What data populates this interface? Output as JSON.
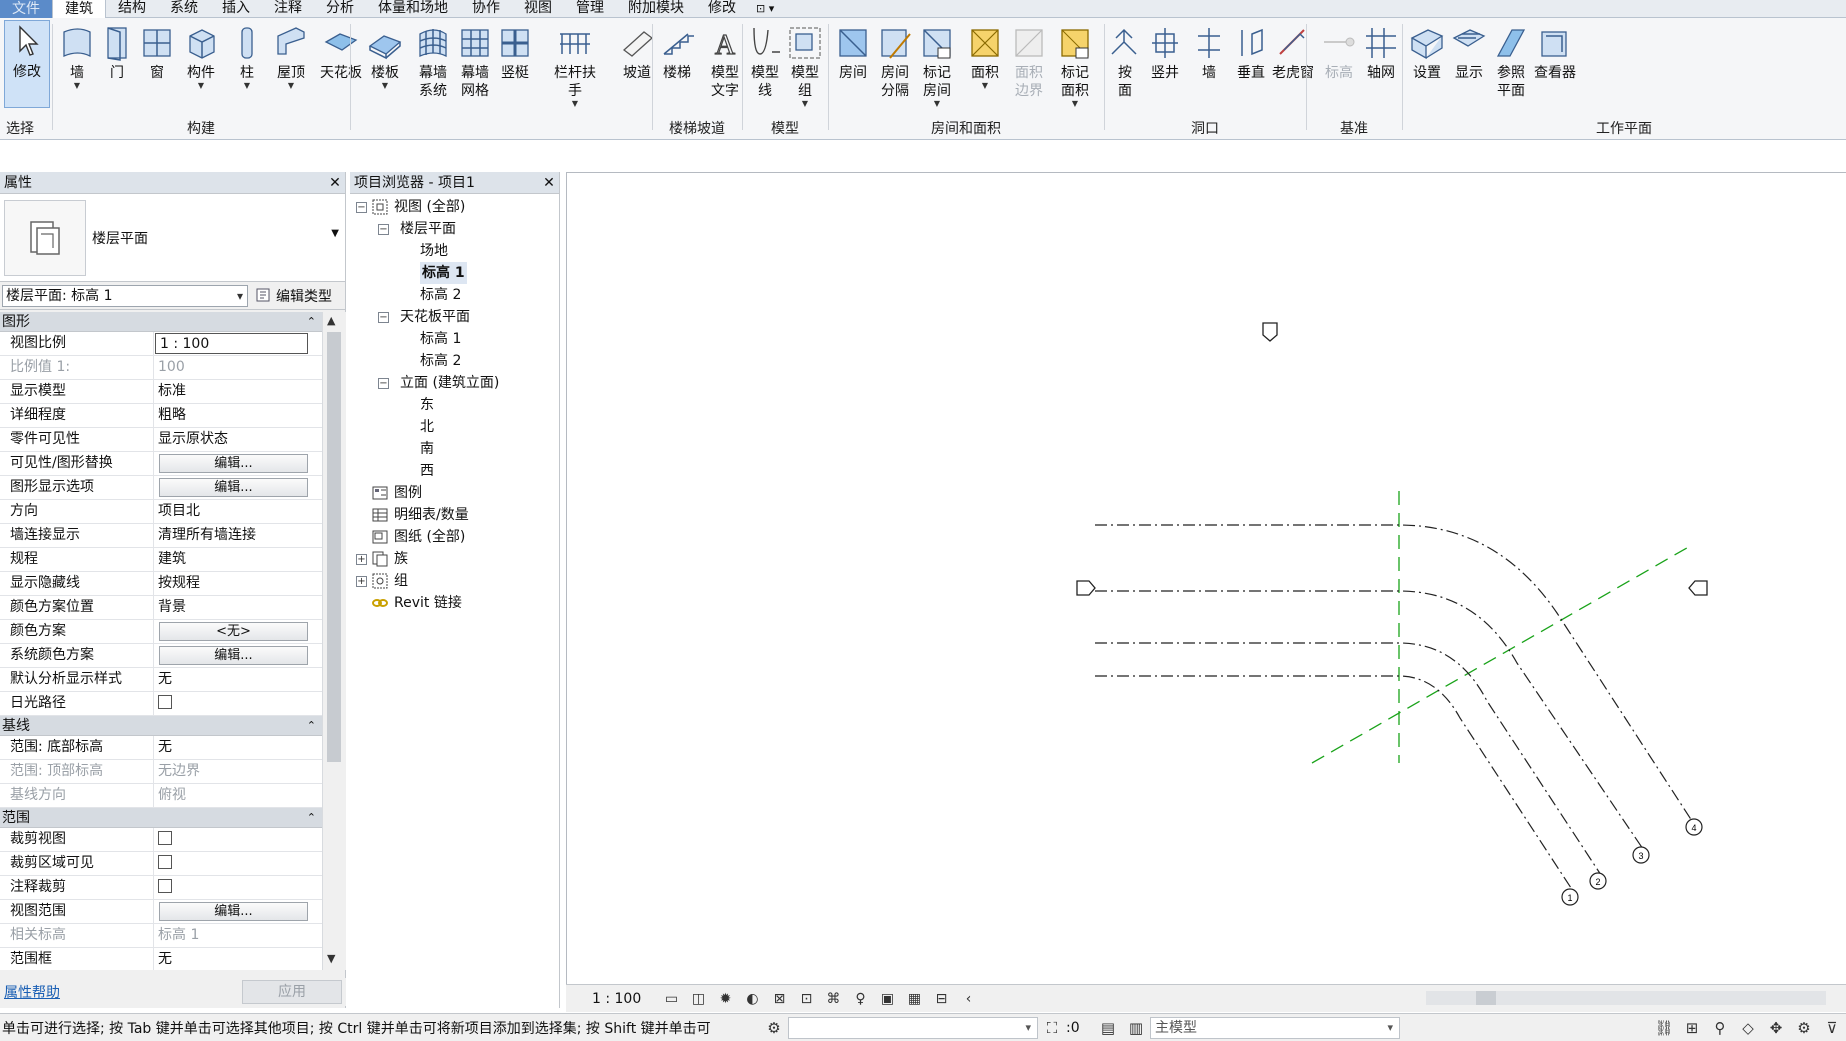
{
  "menu": {
    "file": "文件",
    "tabs": [
      "建筑",
      "结构",
      "系统",
      "插入",
      "注释",
      "分析",
      "体量和场地",
      "协作",
      "视图",
      "管理",
      "附加模块",
      "修改"
    ],
    "active": "建筑",
    "extra": "⊡ ▾"
  },
  "ribbon": {
    "buttons": [
      {
        "name": "modify",
        "label": "修改",
        "icon": "cursor-icon"
      },
      {
        "name": "wall",
        "label": "墙",
        "icon": "wall-icon",
        "caret": true
      },
      {
        "name": "door",
        "label": "门",
        "icon": "door-icon"
      },
      {
        "name": "window",
        "label": "窗",
        "icon": "window-icon"
      },
      {
        "name": "component",
        "label": "构件",
        "icon": "component-icon",
        "caret": true
      },
      {
        "name": "column",
        "label": "柱",
        "icon": "column-icon",
        "caret": true
      },
      {
        "name": "roof",
        "label": "屋顶",
        "icon": "roof-icon",
        "caret": true
      },
      {
        "name": "ceiling",
        "label": "天花板",
        "icon": "ceiling-icon"
      },
      {
        "name": "floor",
        "label": "楼板",
        "icon": "floor-icon",
        "caret": true
      },
      {
        "name": "curtain-system",
        "label": "幕墙\n系统",
        "icon": "curtain-system-icon"
      },
      {
        "name": "curtain-grid",
        "label": "幕墙\n网格",
        "icon": "curtain-grid-icon"
      },
      {
        "name": "mullion",
        "label": "竖梃",
        "icon": "mullion-icon"
      },
      {
        "name": "railing",
        "label": "栏杆扶手",
        "icon": "railing-icon",
        "caret": true
      },
      {
        "name": "ramp",
        "label": "坡道",
        "icon": "ramp-icon"
      },
      {
        "name": "stair",
        "label": "楼梯",
        "icon": "stair-icon"
      },
      {
        "name": "model-text",
        "label": "模型\n文字",
        "icon": "model-text-icon"
      },
      {
        "name": "model-line",
        "label": "模型\n线",
        "icon": "model-line-icon"
      },
      {
        "name": "model-group",
        "label": "模型\n组",
        "icon": "model-group-icon",
        "caret": true
      },
      {
        "name": "room",
        "label": "房间",
        "icon": "room-icon"
      },
      {
        "name": "room-separator",
        "label": "房间\n分隔",
        "icon": "room-separator-icon"
      },
      {
        "name": "tag-room",
        "label": "标记\n房间",
        "icon": "tag-room-icon",
        "caret": true
      },
      {
        "name": "area",
        "label": "面积",
        "icon": "area-icon",
        "caret": true
      },
      {
        "name": "area-boundary",
        "label": "面积\n边界",
        "icon": "area-boundary-icon",
        "dim": true
      },
      {
        "name": "tag-area",
        "label": "标记\n面积",
        "icon": "tag-area-icon",
        "caret": true
      },
      {
        "name": "by-face",
        "label": "按\n面",
        "icon": "by-face-icon"
      },
      {
        "name": "shaft",
        "label": "竖井",
        "icon": "shaft-icon"
      },
      {
        "name": "wall-opening",
        "label": "墙",
        "icon": "wall-opening-icon"
      },
      {
        "name": "vertical",
        "label": "垂直",
        "icon": "vertical-opening-icon"
      },
      {
        "name": "dormer",
        "label": "老虎窗",
        "icon": "dormer-icon"
      },
      {
        "name": "level",
        "label": "标高",
        "icon": "level-icon",
        "dim": true
      },
      {
        "name": "grid",
        "label": "轴网",
        "icon": "grid-icon"
      },
      {
        "name": "set",
        "label": "设置",
        "icon": "set-workplane-icon"
      },
      {
        "name": "show",
        "label": "显示",
        "icon": "show-workplane-icon"
      },
      {
        "name": "ref-plane",
        "label": "参照\n平面",
        "icon": "ref-plane-icon"
      },
      {
        "name": "viewer",
        "label": "查看器",
        "icon": "viewer-icon"
      }
    ],
    "groups": {
      "select": "选择",
      "build": "构建",
      "circulation": "楼梯坡道",
      "model": "模型",
      "room_area": "房间和面积",
      "opening": "洞口",
      "datum": "基准",
      "workplane": "工作平面"
    }
  },
  "properties": {
    "title": "属性",
    "type_name": "楼层平面",
    "selector": "楼层平面: 标高 1",
    "edit_type": "编辑类型",
    "sections": [
      {
        "title": "图形",
        "rows": [
          {
            "k": "视图比例",
            "v": "1 : 100",
            "kind": "input"
          },
          {
            "k": "比例值 1:",
            "v": "100",
            "kind": "dis"
          },
          {
            "k": "显示模型",
            "v": "标准"
          },
          {
            "k": "详细程度",
            "v": "粗略"
          },
          {
            "k": "零件可见性",
            "v": "显示原状态"
          },
          {
            "k": "可见性/图形替换",
            "v": "编辑...",
            "kind": "btn"
          },
          {
            "k": "图形显示选项",
            "v": "编辑...",
            "kind": "btn"
          },
          {
            "k": "方向",
            "v": "项目北"
          },
          {
            "k": "墙连接显示",
            "v": "清理所有墙连接"
          },
          {
            "k": "规程",
            "v": "建筑"
          },
          {
            "k": "显示隐藏线",
            "v": "按规程"
          },
          {
            "k": "颜色方案位置",
            "v": "背景"
          },
          {
            "k": "颜色方案",
            "v": "<无>",
            "kind": "btn"
          },
          {
            "k": "系统颜色方案",
            "v": "编辑...",
            "kind": "btn"
          },
          {
            "k": "默认分析显示样式",
            "v": "无"
          },
          {
            "k": "日光路径",
            "v": "",
            "kind": "cb"
          }
        ]
      },
      {
        "title": "基线",
        "rows": [
          {
            "k": "范围: 底部标高",
            "v": "无"
          },
          {
            "k": "范围: 顶部标高",
            "v": "无边界",
            "kind": "dis"
          },
          {
            "k": "基线方向",
            "v": "俯视",
            "kind": "dis"
          }
        ]
      },
      {
        "title": "范围",
        "rows": [
          {
            "k": "裁剪视图",
            "v": "",
            "kind": "cb"
          },
          {
            "k": "裁剪区域可见",
            "v": "",
            "kind": "cb"
          },
          {
            "k": "注释裁剪",
            "v": "",
            "kind": "cb"
          },
          {
            "k": "视图范围",
            "v": "编辑...",
            "kind": "btn"
          },
          {
            "k": "相关标高",
            "v": "标高 1",
            "kind": "dis"
          },
          {
            "k": "范围框",
            "v": "无"
          }
        ]
      }
    ],
    "help": "属性帮助",
    "apply": "应用"
  },
  "browser": {
    "title": "项目浏览器 - 项目1",
    "nodes": [
      {
        "label": "视图 (全部)",
        "level": 0,
        "toggle": "−",
        "icon": "views-icon"
      },
      {
        "label": "楼层平面",
        "level": 1,
        "toggle": "−"
      },
      {
        "label": "场地",
        "level": 2
      },
      {
        "label": "标高 1",
        "level": 2,
        "selected": true
      },
      {
        "label": "标高 2",
        "level": 2
      },
      {
        "label": "天花板平面",
        "level": 1,
        "toggle": "−"
      },
      {
        "label": "标高 1",
        "level": 2
      },
      {
        "label": "标高 2",
        "level": 2
      },
      {
        "label": "立面 (建筑立面)",
        "level": 1,
        "toggle": "−"
      },
      {
        "label": "东",
        "level": 2
      },
      {
        "label": "北",
        "level": 2
      },
      {
        "label": "南",
        "level": 2
      },
      {
        "label": "西",
        "level": 2
      },
      {
        "label": "图例",
        "level": 0,
        "icon": "legend-icon"
      },
      {
        "label": "明细表/数量",
        "level": 0,
        "icon": "schedule-icon"
      },
      {
        "label": "图纸 (全部)",
        "level": 0,
        "icon": "sheets-icon"
      },
      {
        "label": "族",
        "level": 0,
        "toggle": "+",
        "icon": "families-icon"
      },
      {
        "label": "组",
        "level": 0,
        "toggle": "+",
        "icon": "groups-icon"
      },
      {
        "label": "Revit 链接",
        "level": 0,
        "icon": "revit-link-icon"
      }
    ]
  },
  "canvas": {
    "grid_bubbles": [
      "1",
      "2",
      "3",
      "4"
    ],
    "colors": {
      "grid": "#222222",
      "ref_plane": "#1aa31a"
    }
  },
  "viewbar": {
    "scale": "1 : 100"
  },
  "status": {
    "message": "单击可进行选择; 按 Tab 键并单击可选择其他项目; 按 Ctrl 键并单击可将新项目添加到选择集; 按 Shift 键并单击可",
    "filter_count": ":0",
    "model": "主模型"
  }
}
